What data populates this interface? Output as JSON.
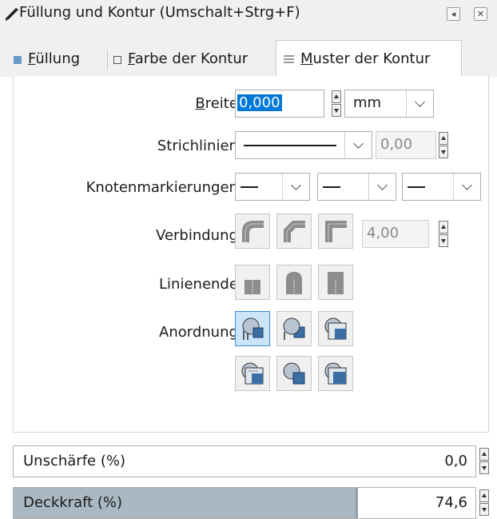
{
  "window": {
    "title": "Füllung und Kontur (Umschalt+Strg+F)",
    "buttons": [
      "◂",
      "✕"
    ]
  },
  "tabs": [
    {
      "prefix": "",
      "mnemonic": "F",
      "rest": "üllung",
      "icon": "fill-square-icon",
      "active": false
    },
    {
      "prefix": "",
      "mnemonic": "F",
      "rest": "arbe der Kontur",
      "icon": "stroke-square-icon",
      "active": false
    },
    {
      "prefix": "",
      "mnemonic": "M",
      "rest": "uster der Kontur",
      "icon": "stroke-lines-icon",
      "active": true
    }
  ],
  "stroke_style": {
    "width": {
      "label_mnemonic": "B",
      "label_rest": "reite:",
      "value": "0,000",
      "unit": "mm"
    },
    "dashes": {
      "label": "Strichlinien:",
      "offset": "0,00"
    },
    "markers": {
      "label": "Knotenmarkierungen:"
    },
    "join": {
      "label": "Verbindung:",
      "miter_limit": "4,00",
      "options": [
        "round-join-icon",
        "bevel-join-icon",
        "miter-join-icon"
      ]
    },
    "cap": {
      "label": "Linienende:",
      "options": [
        "butt-cap-icon",
        "round-cap-icon",
        "square-cap-icon"
      ]
    },
    "order": {
      "label": "Anordnung:",
      "options": [
        "order-1-icon",
        "order-2-icon",
        "order-3-icon",
        "order-4-icon",
        "order-5-icon",
        "order-6-icon"
      ],
      "selected_index": 0
    }
  },
  "blur": {
    "label": "Unschärfe (%)",
    "value": "0,0",
    "level": 0
  },
  "opacity": {
    "label": "Deckkraft (%)",
    "value": "74,6",
    "level": 0.746
  },
  "colors": {
    "accent": "#3c8cd4",
    "selection": "#0078d7",
    "slider_fill": "#a9b8c2"
  }
}
